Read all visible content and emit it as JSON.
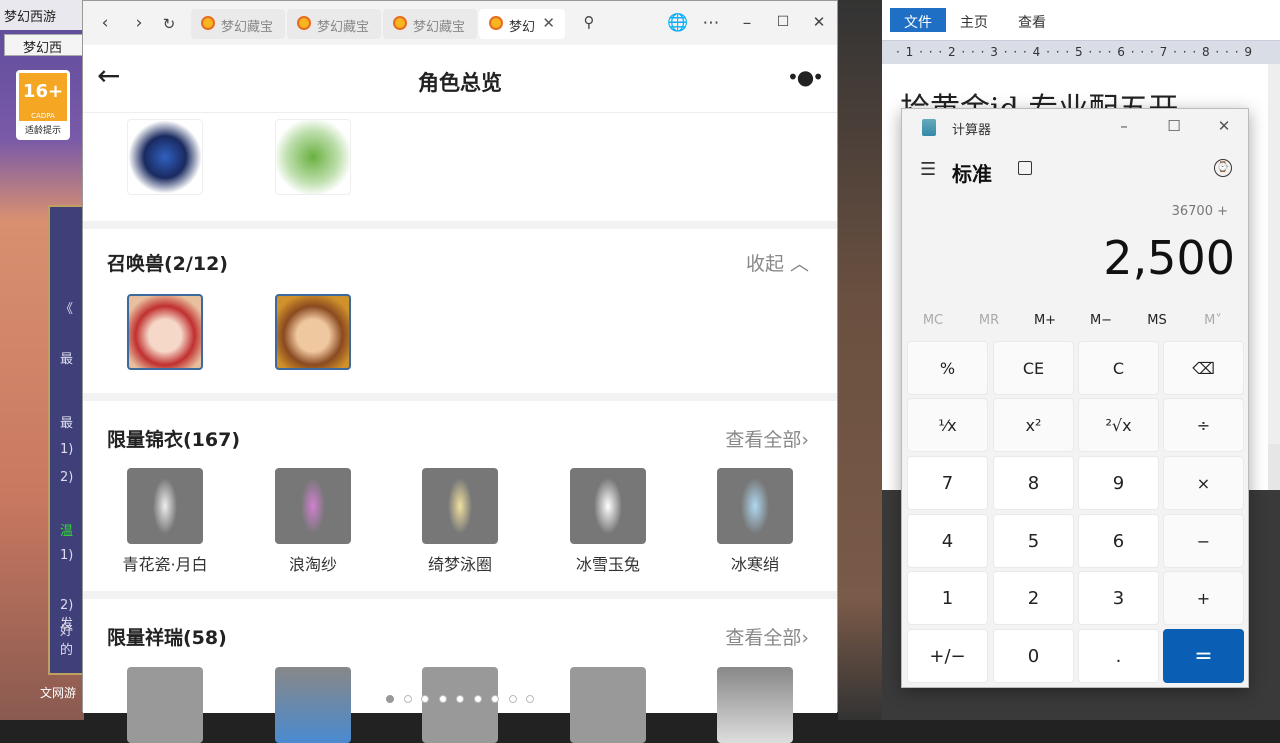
{
  "game_window": {
    "title": "梦幻西游",
    "tab": "梦幻西",
    "age_rating": "16+",
    "age_org": "CADPA",
    "age_tip": "适龄提示",
    "panel_lines": [
      "《",
      "最",
      "最",
      "1)",
      "2)",
      "温",
      "1)",
      "2)发",
      "好的"
    ],
    "footer": "文网游"
  },
  "browser": {
    "tabs": [
      {
        "label": "梦幻藏宝"
      },
      {
        "label": "梦幻藏宝"
      },
      {
        "label": "梦幻藏宝"
      },
      {
        "label": "梦幻"
      }
    ],
    "page_title": "角色总览",
    "sections": {
      "summons": {
        "title": "召唤兽(2/12)",
        "link": "收起"
      },
      "outfits": {
        "title": "限量锦衣(167)",
        "link": "查看全部",
        "items": [
          "青花瓷·月白",
          "浪淘纱",
          "绮梦泳圈",
          "冰雪玉兔",
          "冰寒绡"
        ]
      },
      "auspicious": {
        "title": "限量祥瑞(58)",
        "link": "查看全部"
      }
    },
    "pagination": {
      "total": 9,
      "current": 1
    }
  },
  "word": {
    "tabs": [
      "文件",
      "主页",
      "查看"
    ],
    "ruler": "· 1 · · · 2 · · · 3 · · · 4 · · · 5 · · · 6 · · · 7 · · · 8 · · · 9",
    "doc_text": "拾黄金id 专业配五开"
  },
  "calculator": {
    "title": "计算器",
    "mode": "标准",
    "expression": "36700 +",
    "display": "2,500",
    "memory": [
      "MC",
      "MR",
      "M+",
      "M−",
      "MS",
      "M˅"
    ],
    "keys": [
      "%",
      "CE",
      "C",
      "⌫",
      "⅟x",
      "x²",
      "²√x",
      "÷",
      "7",
      "8",
      "9",
      "×",
      "4",
      "5",
      "6",
      "−",
      "1",
      "2",
      "3",
      "+",
      "+/−",
      "0",
      ".",
      "="
    ],
    "accent": "#0a5fb4"
  }
}
